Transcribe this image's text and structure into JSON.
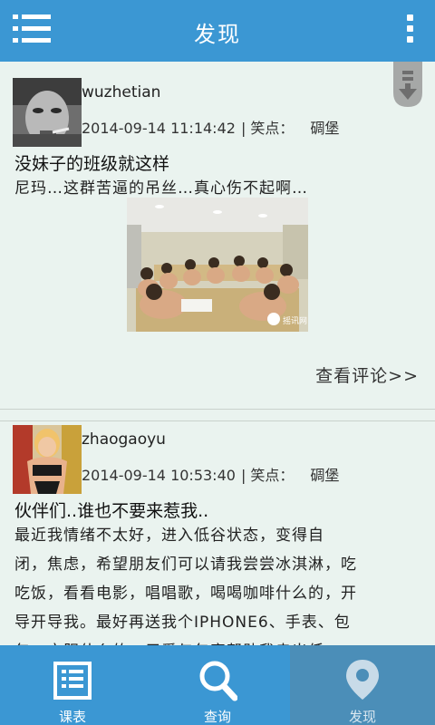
{
  "header": {
    "title": "发现"
  },
  "posts": [
    {
      "username": "wuzhetian",
      "timestamp": "2014-09-14 11:14:42",
      "joke_label": "| 笑点：",
      "joke_value": "碉堡",
      "title": "没妹子的班级就这样",
      "body": "尼玛…这群苦逼的吊丝…真心伤不起啊…",
      "photo_watermark": "摇讯网",
      "comments_label": "查看评论>>"
    },
    {
      "username": "zhaogaoyu",
      "timestamp": "2014-09-14 10:53:40",
      "joke_label": "| 笑点：",
      "joke_value": "碉堡",
      "title": "伙伴们..谁也不要来惹我..",
      "body_lines": [
        "最近我情绪不太好，进入低谷状态，变得自",
        "闭，焦虑，希望朋友们可以请我尝尝冰淇淋，吃",
        "吃饭，看看电影，唱唱歌，喝喝咖啡什么的，开",
        "导开导我。最好再送我个IPHONE6、手表、包",
        "包、衣服什么的，用爱与包容帮助我走出低"
      ]
    }
  ],
  "tabbar": {
    "tabs": [
      {
        "label": "课表",
        "icon": "timetable-icon"
      },
      {
        "label": "查询",
        "icon": "search-icon"
      },
      {
        "label": "发现",
        "icon": "location-pin-icon"
      }
    ],
    "active_index": 2
  },
  "colors": {
    "bar_blue": "#3b97d3",
    "active_tab": "#4b8eb8",
    "feed_bg": "#eaf3ef"
  }
}
